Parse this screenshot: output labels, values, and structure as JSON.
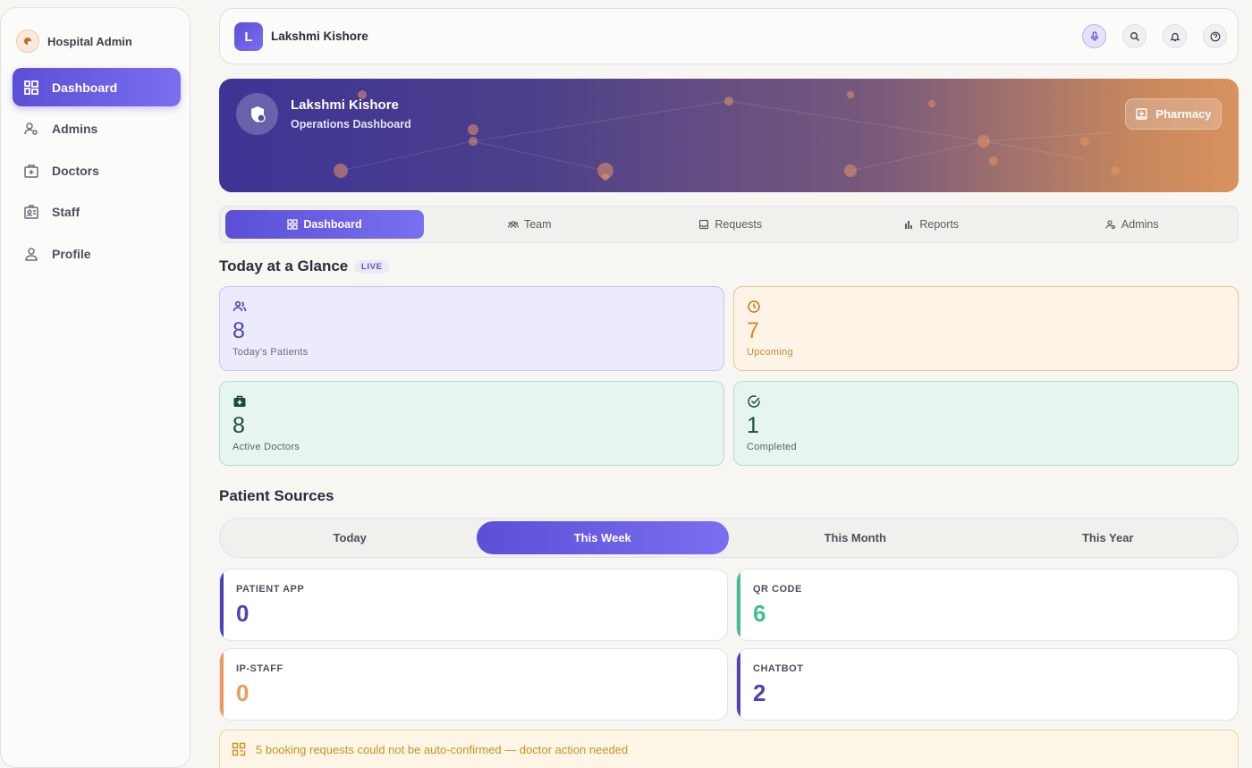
{
  "sidebar": {
    "brand": "Hospital Admin",
    "items": [
      {
        "label": "Dashboard"
      },
      {
        "label": "Admins"
      },
      {
        "label": "Doctors"
      },
      {
        "label": "Staff"
      },
      {
        "label": "Profile"
      }
    ]
  },
  "topbar": {
    "avatar_letter": "L",
    "user_name": "Lakshmi Kishore"
  },
  "hero": {
    "name": "Lakshmi Kishore",
    "subtitle": "Operations Dashboard",
    "button_label": "Pharmacy"
  },
  "tabs": [
    {
      "label": "Dashboard"
    },
    {
      "label": "Team"
    },
    {
      "label": "Requests"
    },
    {
      "label": "Reports"
    },
    {
      "label": "Admins"
    }
  ],
  "glance": {
    "title": "Today at a Glance",
    "badge": "LIVE",
    "stats": [
      {
        "value": "8",
        "label": "Today's Patients"
      },
      {
        "value": "7",
        "label": "Upcoming"
      },
      {
        "value": "8",
        "label": "Active Doctors"
      },
      {
        "value": "1",
        "label": "Completed"
      }
    ]
  },
  "sources": {
    "title": "Patient Sources",
    "periods": [
      "Today",
      "This Week",
      "This Month",
      "This Year"
    ],
    "selected_period": "This Week",
    "cards": [
      {
        "label": "PATIENT APP",
        "value": "0",
        "color": "#4c43b8"
      },
      {
        "label": "QR CODE",
        "value": "6",
        "color": "#3fbf8a"
      },
      {
        "label": "IP-STAFF",
        "value": "0",
        "color": "#ee9a5a"
      },
      {
        "label": "CHATBOT",
        "value": "2",
        "color": "#4c43b8"
      }
    ]
  },
  "alert": {
    "text": "5 booking requests could not be auto-confirmed — doctor action needed"
  },
  "colors": {
    "accent": "#5b4fd6",
    "orange": "#d88a1f",
    "green": "#1d4a35"
  }
}
